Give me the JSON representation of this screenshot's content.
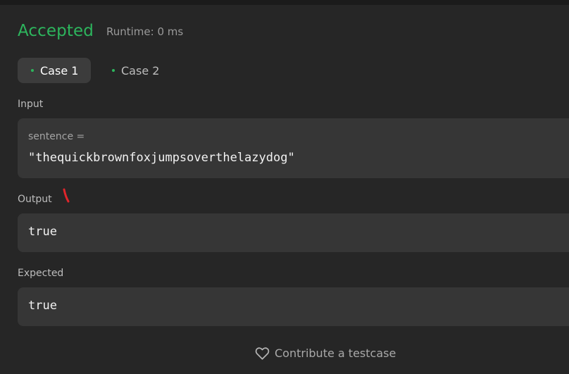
{
  "result": {
    "status": "Accepted",
    "runtime": "Runtime: 0 ms"
  },
  "tabs": [
    {
      "label": "Case 1",
      "active": true
    },
    {
      "label": "Case 2",
      "active": false
    }
  ],
  "input": {
    "label": "Input",
    "param_name": "sentence =",
    "param_value": "\"thequickbrownfoxjumpsoverthelazydog\""
  },
  "output": {
    "label": "Output",
    "value": "true"
  },
  "expected": {
    "label": "Expected",
    "value": "true"
  },
  "footer": {
    "contribute_label": "Contribute a testcase",
    "icon": "heart-icon"
  },
  "colors": {
    "accepted": "#2db55d",
    "background": "#262626",
    "box": "#363636",
    "annotation": "#e0252b"
  }
}
